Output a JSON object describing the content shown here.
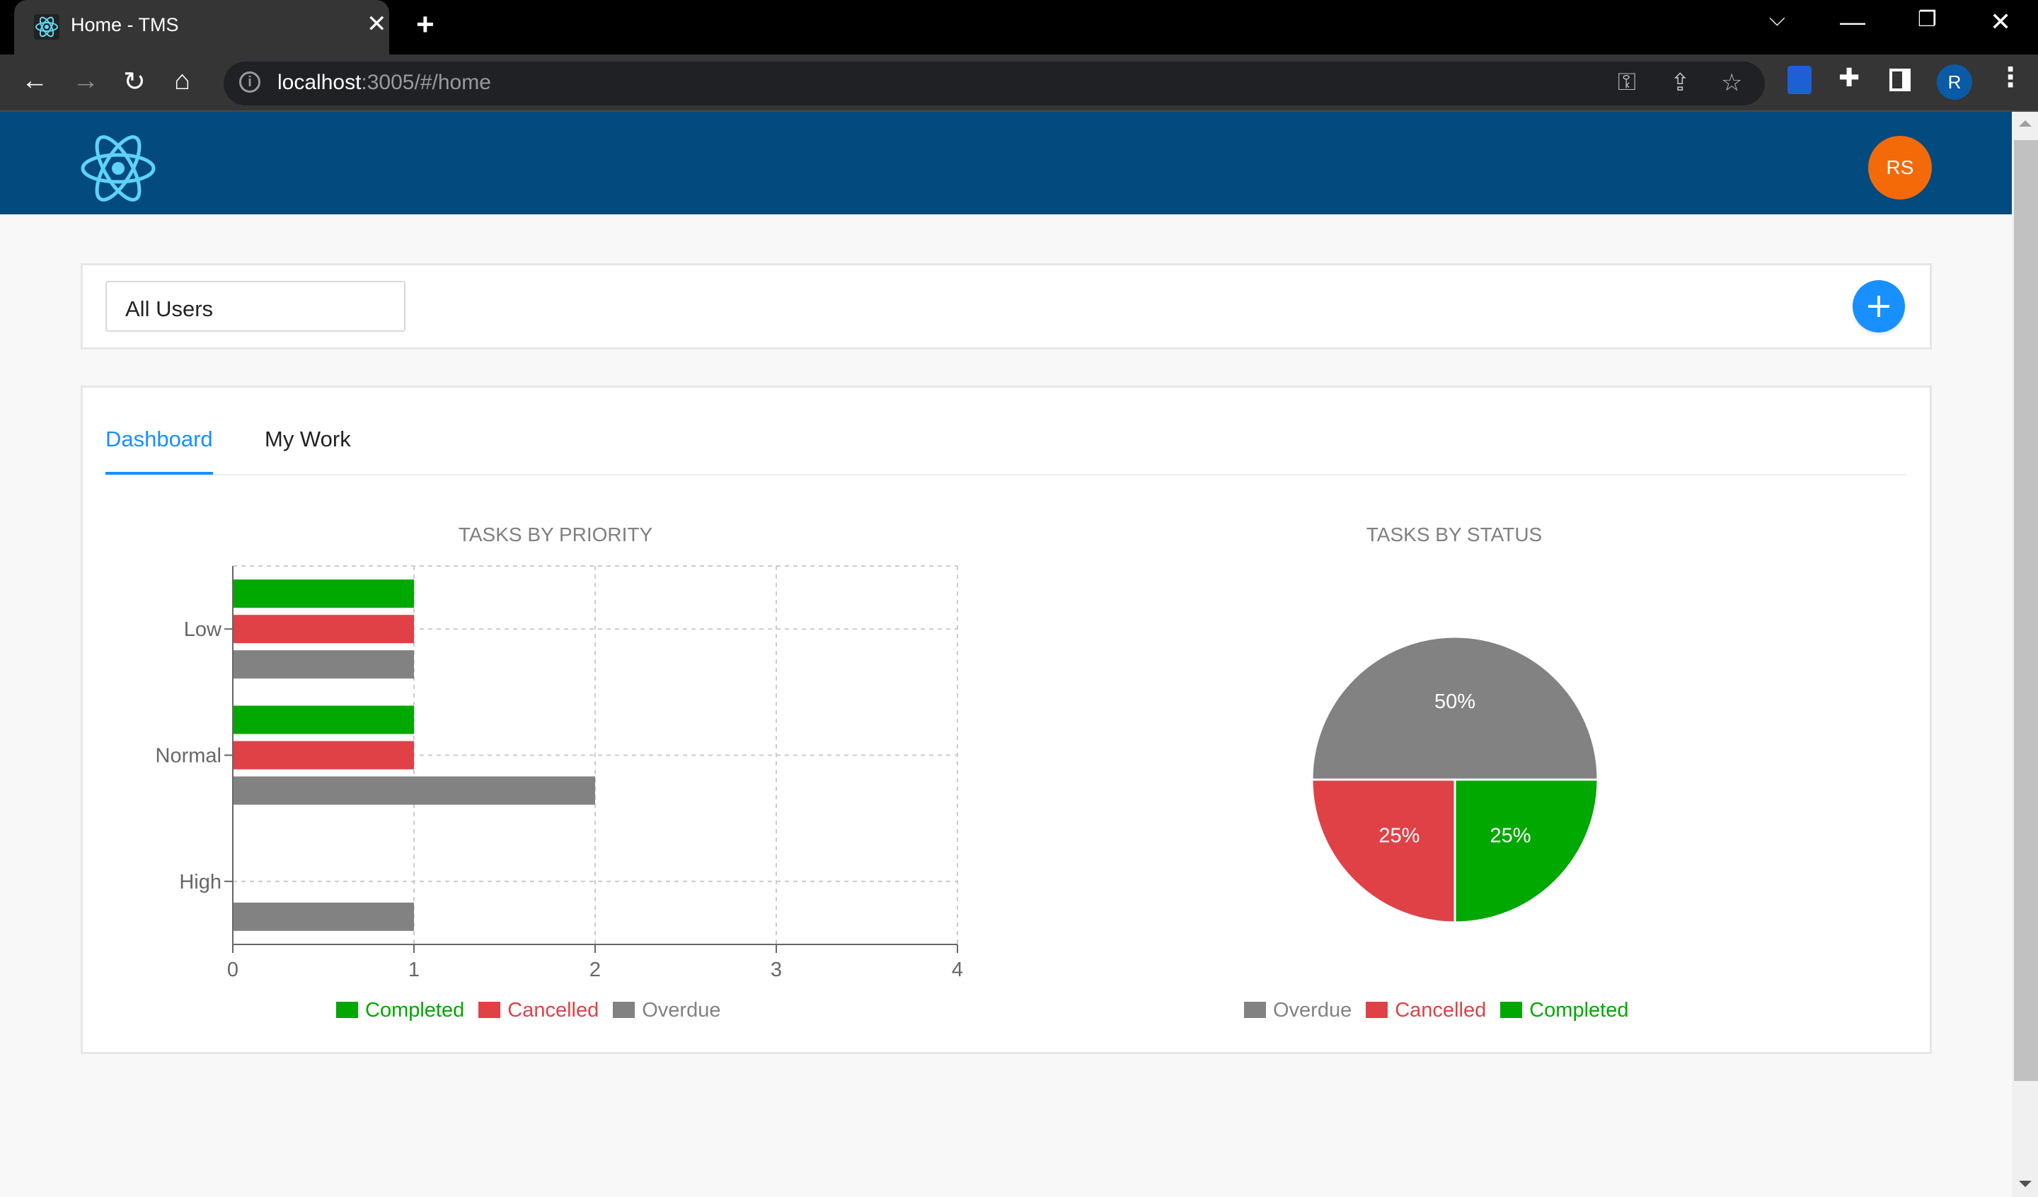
{
  "browser": {
    "tab_title": "Home - TMS",
    "url_host": "localhost",
    "url_rest": ":3005/#/home",
    "profile_initial": "R",
    "icons": [
      "react-favicon",
      "close-icon",
      "new-tab-icon",
      "chevron-down-icon",
      "minimize-icon",
      "restore-icon",
      "window-close-icon",
      "back-icon",
      "forward-icon",
      "reload-icon",
      "home-icon",
      "info-icon",
      "key-icon",
      "share-icon",
      "star-icon",
      "bitwarden-icon",
      "puzzle-icon",
      "side-panel-icon",
      "more-icon"
    ]
  },
  "header": {
    "logo": "react-logo",
    "avatar_initials": "RS",
    "colors": {
      "bar": "#034a7e",
      "avatar": "#f46a09"
    }
  },
  "filter": {
    "user_select_value": "All Users",
    "add_button_icon": "plus-icon",
    "accent": "#1890ff"
  },
  "tabs": [
    {
      "label": "Dashboard",
      "active": true
    },
    {
      "label": "My Work",
      "active": false
    }
  ],
  "chart_data": [
    {
      "type": "bar",
      "orientation": "horizontal",
      "title": "TASKS BY PRIORITY",
      "categories": [
        "Low",
        "Normal",
        "High"
      ],
      "series": [
        {
          "name": "Completed",
          "color": "#00a800",
          "values": [
            1,
            1,
            0
          ]
        },
        {
          "name": "Cancelled",
          "color": "#e04147",
          "values": [
            1,
            1,
            0
          ]
        },
        {
          "name": "Overdue",
          "color": "#828282",
          "values": [
            1,
            2,
            1
          ]
        }
      ],
      "xlim": [
        0,
        4
      ],
      "xticks": [
        "0",
        "1",
        "2",
        "3",
        "4"
      ],
      "grid": true,
      "legend": "bottom"
    },
    {
      "type": "pie",
      "title": "TASKS BY STATUS",
      "slices": [
        {
          "name": "Overdue",
          "value": 50,
          "label": "50%",
          "color": "#828282"
        },
        {
          "name": "Completed",
          "value": 25,
          "label": "25%",
          "color": "#00a800"
        },
        {
          "name": "Cancelled",
          "value": 25,
          "label": "25%",
          "color": "#e04147"
        }
      ],
      "legend_order": [
        "Overdue",
        "Cancelled",
        "Completed"
      ],
      "legend": "bottom"
    }
  ]
}
